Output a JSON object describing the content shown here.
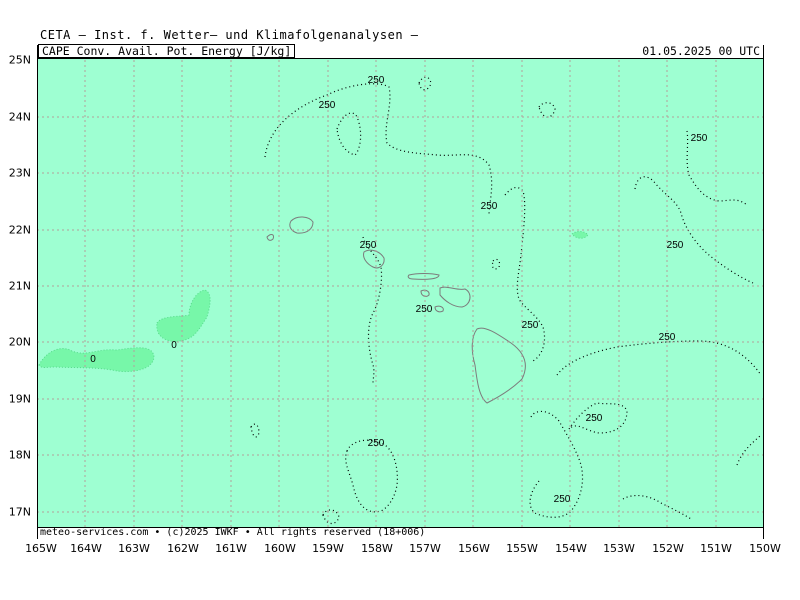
{
  "header": {
    "title": "CETA — Inst. f. Wetter— und Klimafolgenanalysen —"
  },
  "map": {
    "parameter_label": "CAPE_Conv._Avail._Pot._Energy_[J/kg]",
    "valid_time": "01.05.2025 00 UTC",
    "footer": "meteo-services.com • (c)2025 IWKF • All rights reserved (18+006)",
    "lat_labels": [
      "25N",
      "24N",
      "23N",
      "22N",
      "21N",
      "20N",
      "19N",
      "18N",
      "17N"
    ],
    "lon_labels": [
      "165W",
      "164W",
      "163W",
      "162W",
      "161W",
      "160W",
      "159W",
      "158W",
      "157W",
      "156W",
      "155W",
      "154W",
      "153W",
      "152W",
      "151W",
      "150W"
    ],
    "contour_labels": [
      "250",
      "250",
      "250",
      "250",
      "250",
      "250",
      "250",
      "250",
      "250",
      "250",
      "250",
      "250",
      "250",
      "0",
      "0"
    ],
    "colors": {
      "field_background": "#9effd2",
      "low_cape_fill": "#77f7a9",
      "grid": "#b3a09a",
      "coast": "#7c7c7c"
    }
  }
}
